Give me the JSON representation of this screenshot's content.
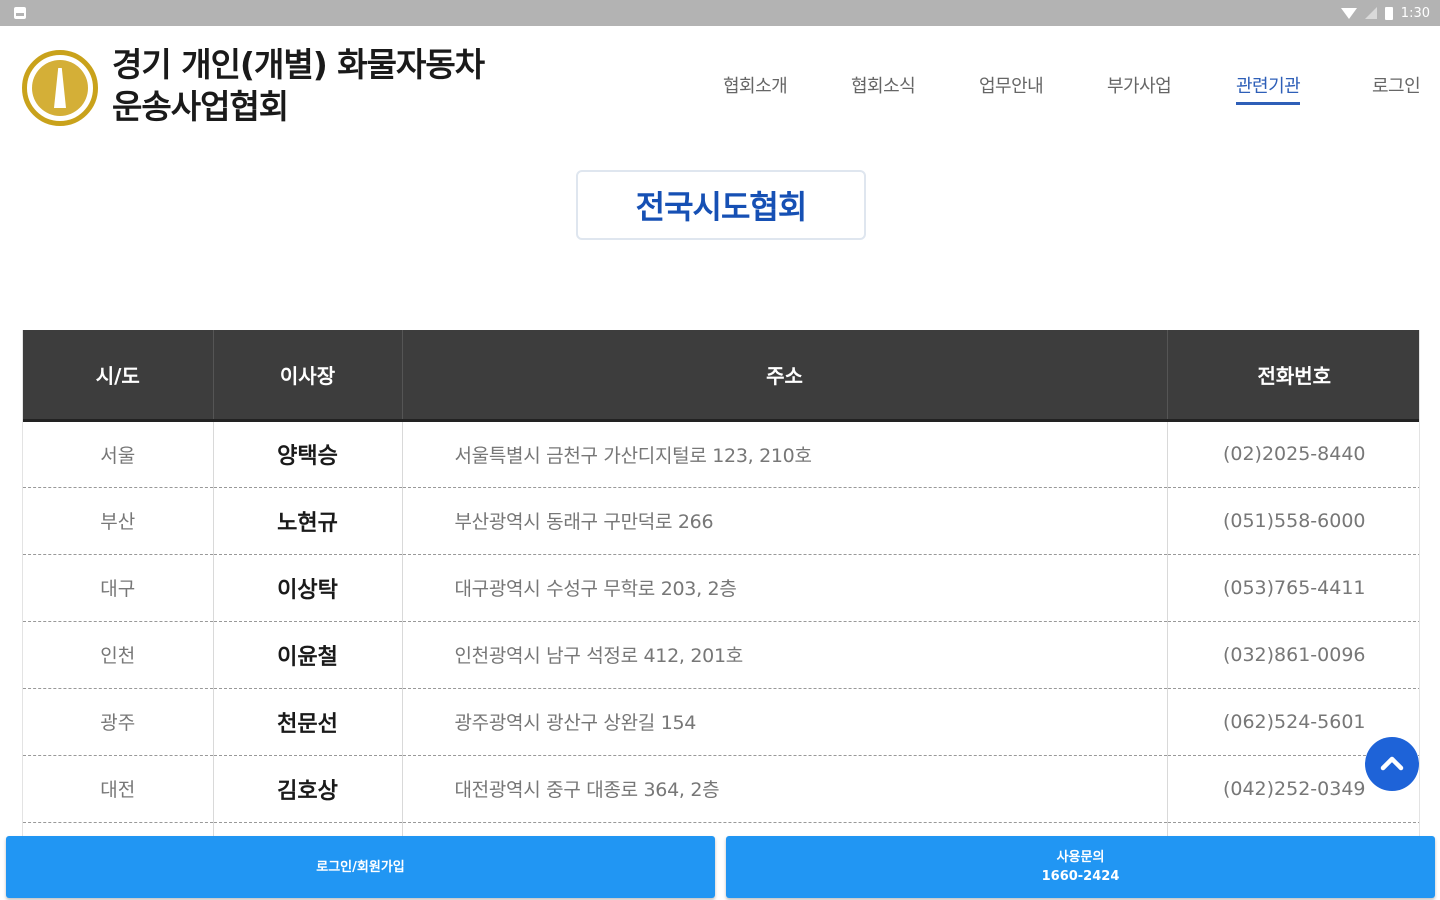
{
  "status_bar": {
    "time": "1:30"
  },
  "header": {
    "title_line1": "경기 개인(개별) 화물자동차",
    "title_line2": "운송사업협회",
    "nav": [
      {
        "label": "협회소개"
      },
      {
        "label": "협회소식"
      },
      {
        "label": "업무안내"
      },
      {
        "label": "부가사업"
      },
      {
        "label": "관련기관",
        "active": true
      },
      {
        "label": "로그인"
      }
    ]
  },
  "page": {
    "heading": "전국시도협회"
  },
  "table": {
    "columns": [
      "시/도",
      "이사장",
      "주소",
      "전화번호"
    ],
    "rows": [
      {
        "city": "서울",
        "chair": "양택승",
        "address": "서울특별시 금천구 가산디지털로 123, 210호",
        "phone": "(02)2025-8440"
      },
      {
        "city": "부산",
        "chair": "노현규",
        "address": "부산광역시 동래구 구만덕로 266",
        "phone": "(051)558-6000"
      },
      {
        "city": "대구",
        "chair": "이상탁",
        "address": "대구광역시 수성구 무학로 203, 2층",
        "phone": "(053)765-4411"
      },
      {
        "city": "인천",
        "chair": "이윤철",
        "address": "인천광역시 남구 석정로 412, 201호",
        "phone": "(032)861-0096"
      },
      {
        "city": "광주",
        "chair": "천문선",
        "address": "광주광역시 광산구 상완길 154",
        "phone": "(062)524-5601"
      },
      {
        "city": "대전",
        "chair": "김호상",
        "address": "대전광역시 중구 대종로 364, 2층",
        "phone": "(042)252-0349"
      }
    ]
  },
  "bottom_bar": {
    "login_label": "로그인/회원가입",
    "inquiry_label": "사용문의",
    "inquiry_phone": "1660-2424"
  },
  "colors": {
    "accent": "#1650b4",
    "nav_active": "#2e5fb8",
    "button": "#2196f3",
    "table_header": "#3d3d3d",
    "logo_gold": "#c9a21b"
  }
}
